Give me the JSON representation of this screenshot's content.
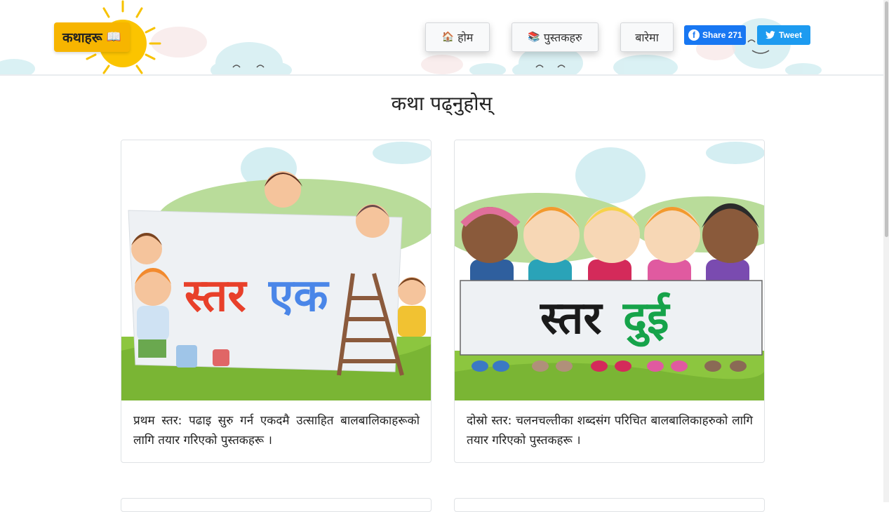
{
  "header": {
    "brand_label": "कथाहरू",
    "brand_icon": "book-icon",
    "nav": [
      {
        "label": "होम",
        "icon": "house-icon"
      },
      {
        "label": "पुस्तकहरु",
        "icon": "books-icon"
      },
      {
        "label": "बारेमा"
      }
    ],
    "fb_share_label": "Share 271",
    "tweet_label": "Tweet"
  },
  "main": {
    "title": "कथा पढ्नुहोस्",
    "cards": [
      {
        "banner_word1": "स्तर",
        "banner_word2": "एक",
        "description": "प्रथम स्तर: पढाइ सुरु गर्न एकदमै उत्साहित बालबालिकाहरूको लागि तयार गरिएको पुस्तकहरू ।"
      },
      {
        "banner_word1": "स्तर",
        "banner_word2": "दुई",
        "description": "दोस्रो स्तर: चलनचल्तीका शब्दसंग परिचित बालबालिकाहरुको लागि तयार गरिएको पुस्तकहरू ।"
      }
    ]
  },
  "colors": {
    "brand_bg": "#f7b500",
    "facebook": "#1877f2",
    "twitter": "#1d9bf0",
    "level1_word1": "#e8402a",
    "level1_word2": "#4a86e8",
    "level2_word1": "#1a1a1a",
    "level2_word2": "#16a34a"
  }
}
